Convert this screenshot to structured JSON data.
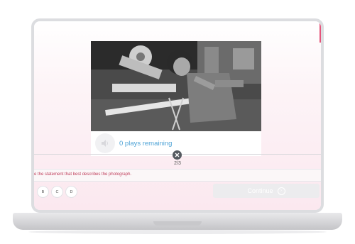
{
  "audio": {
    "plays_remaining": "0 plays remaining",
    "play_icon": "speaker-icon"
  },
  "navigation": {
    "counter": "2/3",
    "close_icon": "close-icon"
  },
  "question": {
    "text": "e the statement that best describes the photograph."
  },
  "answers": [
    "B",
    "C",
    "D"
  ],
  "continue": {
    "label": "Continue",
    "icon": "arrow-circle-icon"
  },
  "colors": {
    "accent": "#c0405d",
    "plays_text": "#4fa3d6",
    "continue_disabled": "#ececee"
  }
}
